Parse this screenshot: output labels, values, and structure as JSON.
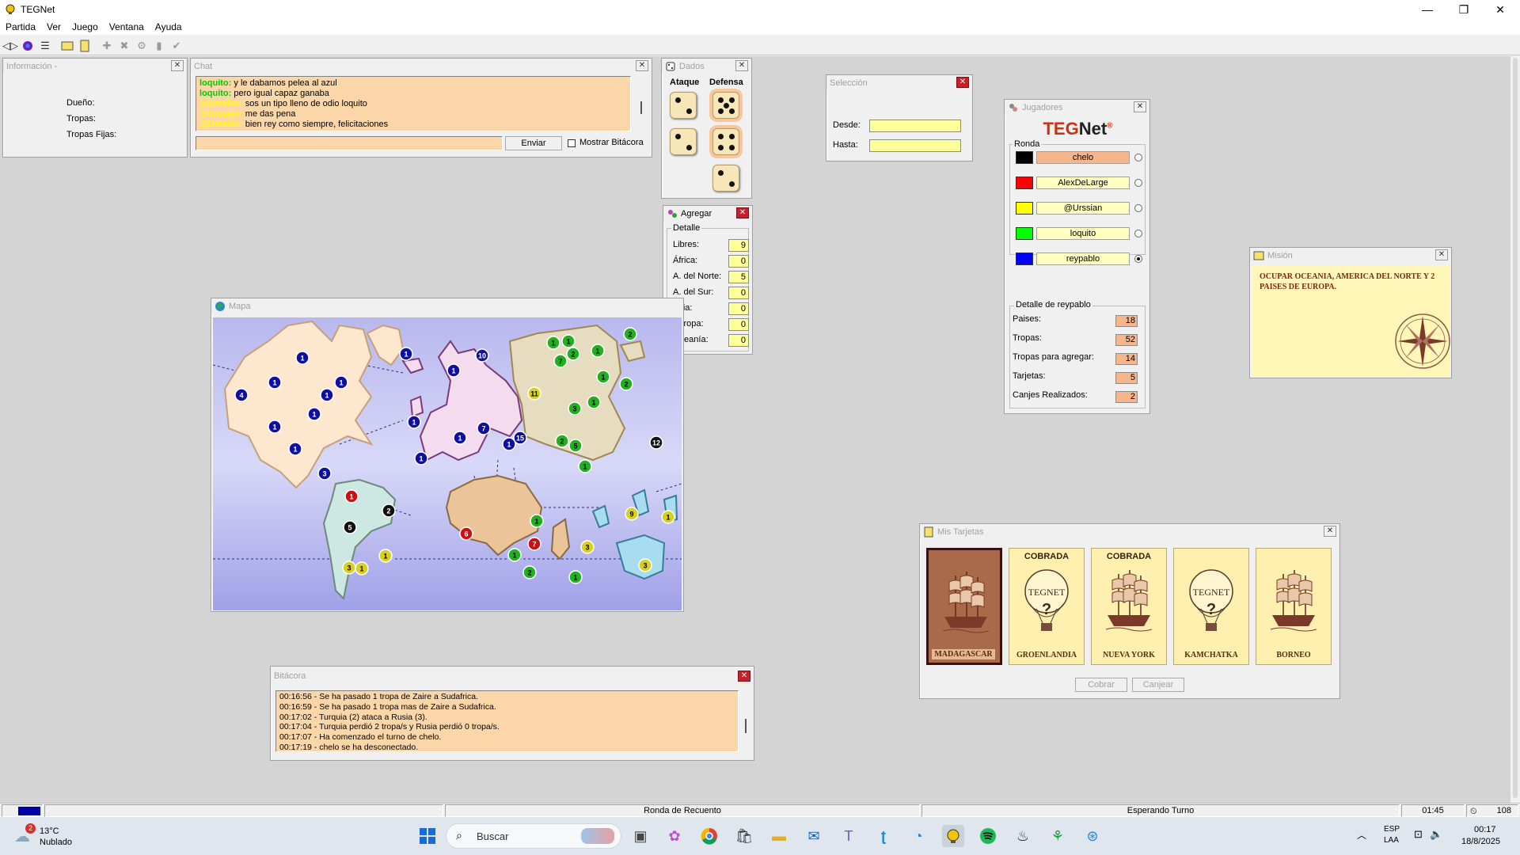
{
  "app": {
    "title": "TEGNet",
    "menu": [
      "Partida",
      "Ver",
      "Juego",
      "Ventana",
      "Ayuda"
    ]
  },
  "window_controls": {
    "minimize": "—",
    "maximize": "❐",
    "close": "✕"
  },
  "info": {
    "title": "Información -",
    "owner_label": "Dueño:",
    "troops_label": "Tropas:",
    "fixed_label": "Tropas Fijas:"
  },
  "chat": {
    "title": "Chat",
    "lines": [
      {
        "name": "loquito",
        "color": "#00cc00",
        "text": "y le dabamos pelea al azul"
      },
      {
        "name": "loquito",
        "color": "#00cc00",
        "text": "pero igual capaz ganaba"
      },
      {
        "name": "@Urssian",
        "color": "#ffff00",
        "text": "sos un tipo lleno de odio loquito"
      },
      {
        "name": "@Urssian",
        "color": "#ffff00",
        "text": "me das pena"
      },
      {
        "name": "@Urssian",
        "color": "#ffff00",
        "text": "bien rey como siempre, felicitaciones"
      }
    ],
    "input_value": "",
    "send_label": "Enviar",
    "show_log_label": "Mostrar Bitácora"
  },
  "dice": {
    "title": "Dados",
    "attack_label": "Ataque",
    "defense_label": "Defensa",
    "attack": [
      2,
      2
    ],
    "defense": [
      5,
      4,
      2
    ]
  },
  "seleccion": {
    "title": "Selección",
    "from_label": "Desde:",
    "to_label": "Hasta:",
    "from_value": "",
    "to_value": ""
  },
  "agregar": {
    "title": "Agregar",
    "group_label": "Detalle",
    "rows": [
      {
        "label": "Libres:",
        "value": "9"
      },
      {
        "label": "África:",
        "value": "0"
      },
      {
        "label": "A. del Norte:",
        "value": "5"
      },
      {
        "label": "A. del Sur:",
        "value": "0"
      },
      {
        "label": "Asia:",
        "value": "0"
      },
      {
        "label": "Europa:",
        "value": "0"
      },
      {
        "label": "Oceanía:",
        "value": "0"
      }
    ]
  },
  "jugadores": {
    "title": "Jugadores",
    "logo_teg": "TEG",
    "logo_net": "Net",
    "logo_reg": "®",
    "round_label": "Ronda",
    "players": [
      {
        "name": "chelo",
        "color": "#000000",
        "current": true,
        "selected": false
      },
      {
        "name": "AlexDeLarge",
        "color": "#ff0000",
        "current": false,
        "selected": false
      },
      {
        "name": "@Urssian",
        "color": "#ffff00",
        "current": false,
        "selected": false
      },
      {
        "name": "loquito",
        "color": "#00ff00",
        "current": false,
        "selected": false
      },
      {
        "name": "reypablo",
        "color": "#0000ff",
        "current": false,
        "selected": true
      }
    ],
    "detail_label": "Detalle de reypablo",
    "details": [
      {
        "label": "Paises:",
        "value": "18"
      },
      {
        "label": "Tropas:",
        "value": "52"
      },
      {
        "label": "Tropas para agregar:",
        "value": "14"
      },
      {
        "label": "Tarjetas:",
        "value": "5"
      },
      {
        "label": "Canjes Realizados:",
        "value": "2"
      }
    ]
  },
  "mision": {
    "title": "Misión",
    "text": "OCUPAR OCEANIA, AMERICA DEL NORTE Y 2 PAISES DE EUROPA."
  },
  "mapa": {
    "title": "Mapa",
    "markers": [
      {
        "v": "1",
        "c": "blue"
      },
      {
        "v": "1",
        "c": "blue"
      },
      {
        "v": "1",
        "c": "blue"
      },
      {
        "v": "4",
        "c": "blue"
      },
      {
        "v": "1",
        "c": "blue"
      },
      {
        "v": "1",
        "c": "blue"
      },
      {
        "v": "1",
        "c": "blue"
      },
      {
        "v": "1",
        "c": "blue"
      },
      {
        "v": "1",
        "c": "blue"
      },
      {
        "v": "3",
        "c": "blue"
      },
      {
        "v": "1",
        "c": "blue"
      },
      {
        "v": "1",
        "c": "red"
      },
      {
        "v": "2",
        "c": "black"
      },
      {
        "v": "5",
        "c": "black"
      },
      {
        "v": "3",
        "c": "yellow"
      },
      {
        "v": "1",
        "c": "yellow"
      },
      {
        "v": "1",
        "c": "yellow"
      },
      {
        "v": "1",
        "c": "blue"
      },
      {
        "v": "10",
        "c": "blue"
      },
      {
        "v": "1",
        "c": "blue"
      },
      {
        "v": "15",
        "c": "blue"
      },
      {
        "v": "1",
        "c": "blue"
      },
      {
        "v": "7",
        "c": "blue"
      },
      {
        "v": "1",
        "c": "blue"
      },
      {
        "v": "1",
        "c": "blue"
      },
      {
        "v": "11",
        "c": "yellow"
      },
      {
        "v": "1",
        "c": "green"
      },
      {
        "v": "1",
        "c": "green"
      },
      {
        "v": "2",
        "c": "green"
      },
      {
        "v": "7",
        "c": "green"
      },
      {
        "v": "2",
        "c": "green"
      },
      {
        "v": "1",
        "c": "green"
      },
      {
        "v": "2",
        "c": "green"
      },
      {
        "v": "1",
        "c": "green"
      },
      {
        "v": "3",
        "c": "green"
      },
      {
        "v": "1",
        "c": "green"
      },
      {
        "v": "2",
        "c": "green"
      },
      {
        "v": "5",
        "c": "green"
      },
      {
        "v": "1",
        "c": "green"
      },
      {
        "v": "12",
        "c": "black"
      },
      {
        "v": "6",
        "c": "red"
      },
      {
        "v": "1",
        "c": "green"
      },
      {
        "v": "7",
        "c": "red"
      },
      {
        "v": "1",
        "c": "green"
      },
      {
        "v": "2",
        "c": "green"
      },
      {
        "v": "1",
        "c": "green"
      },
      {
        "v": "3",
        "c": "yellow"
      },
      {
        "v": "9",
        "c": "yellow"
      },
      {
        "v": "1",
        "c": "yellow"
      },
      {
        "v": "3",
        "c": "yellow"
      }
    ]
  },
  "tarjetas": {
    "title": "Mis Tarjetas",
    "cards": [
      {
        "name": "MADAGASCAR",
        "cobrada": "",
        "symbol": "ship",
        "selected": true
      },
      {
        "name": "GROENLANDIA",
        "cobrada": "COBRADA",
        "symbol": "balloon",
        "selected": false
      },
      {
        "name": "NUEVA YORK",
        "cobrada": "COBRADA",
        "symbol": "ship",
        "selected": false
      },
      {
        "name": "KAMCHATKA",
        "cobrada": "",
        "symbol": "balloon",
        "selected": false
      },
      {
        "name": "BORNEO",
        "cobrada": "",
        "symbol": "ship",
        "selected": false
      }
    ],
    "collect_label": "Cobrar",
    "exchange_label": "Canjear",
    "balloon_text": "TEGNET"
  },
  "bitacora": {
    "title": "Bitácora",
    "lines": [
      "00:16:56 - Se ha pasado 1 tropa de Zaire a Sudafrica.",
      "00:16:59 - Se ha pasado 1 tropa mas de Zaire a Sudafrica.",
      "00:17:02 - Turquia (2) ataca a Rusia (3).",
      "00:17:04 - Turquia perdió 2 tropa/s y Rusia perdió 0 tropa/s.",
      "00:17:07 - Ha comenzado el turno de chelo.",
      "00:17:19 - chelo se ha desconectado."
    ]
  },
  "status": {
    "round": "Ronda de Recuento",
    "state": "Esperando Turno",
    "timer": "01:45",
    "count": "108",
    "color": "#0000aa"
  },
  "taskbar": {
    "weather_temp": "13°C",
    "weather_desc": "Nublado",
    "weather_badge": "2",
    "search_placeholder": "Buscar",
    "lang_top": "ESP",
    "lang_bottom": "LAA",
    "time": "00:17",
    "date": "18/8/2025"
  }
}
